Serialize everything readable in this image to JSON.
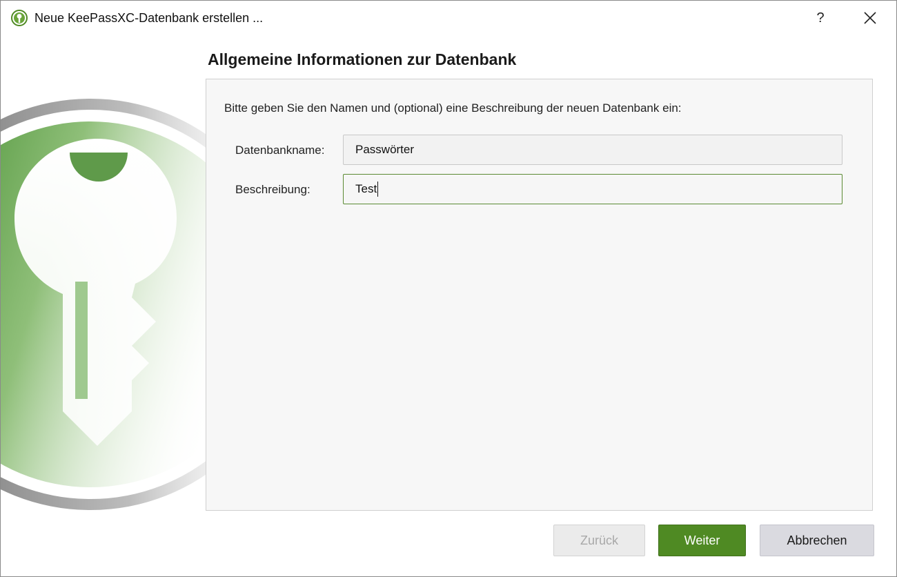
{
  "window": {
    "title": "Neue KeePassXC-Datenbank erstellen ...",
    "help_label": "?",
    "close_label": "✕"
  },
  "page": {
    "heading": "Allgemeine Informationen zur Datenbank",
    "intro": "Bitte geben Sie den Namen und (optional) eine Beschreibung der neuen Datenbank ein:"
  },
  "form": {
    "name_label": "Datenbankname:",
    "name_value": "Passwörter",
    "description_label": "Beschreibung:",
    "description_value": "Test"
  },
  "buttons": {
    "back": "Zurück",
    "next": "Weiter",
    "cancel": "Abbrechen"
  },
  "colors": {
    "accent": "#4f8a23",
    "focus_border": "#5a8a32"
  },
  "icons": {
    "app": "keepassxc-logo-icon",
    "background": "keepassxc-key-watermark"
  }
}
